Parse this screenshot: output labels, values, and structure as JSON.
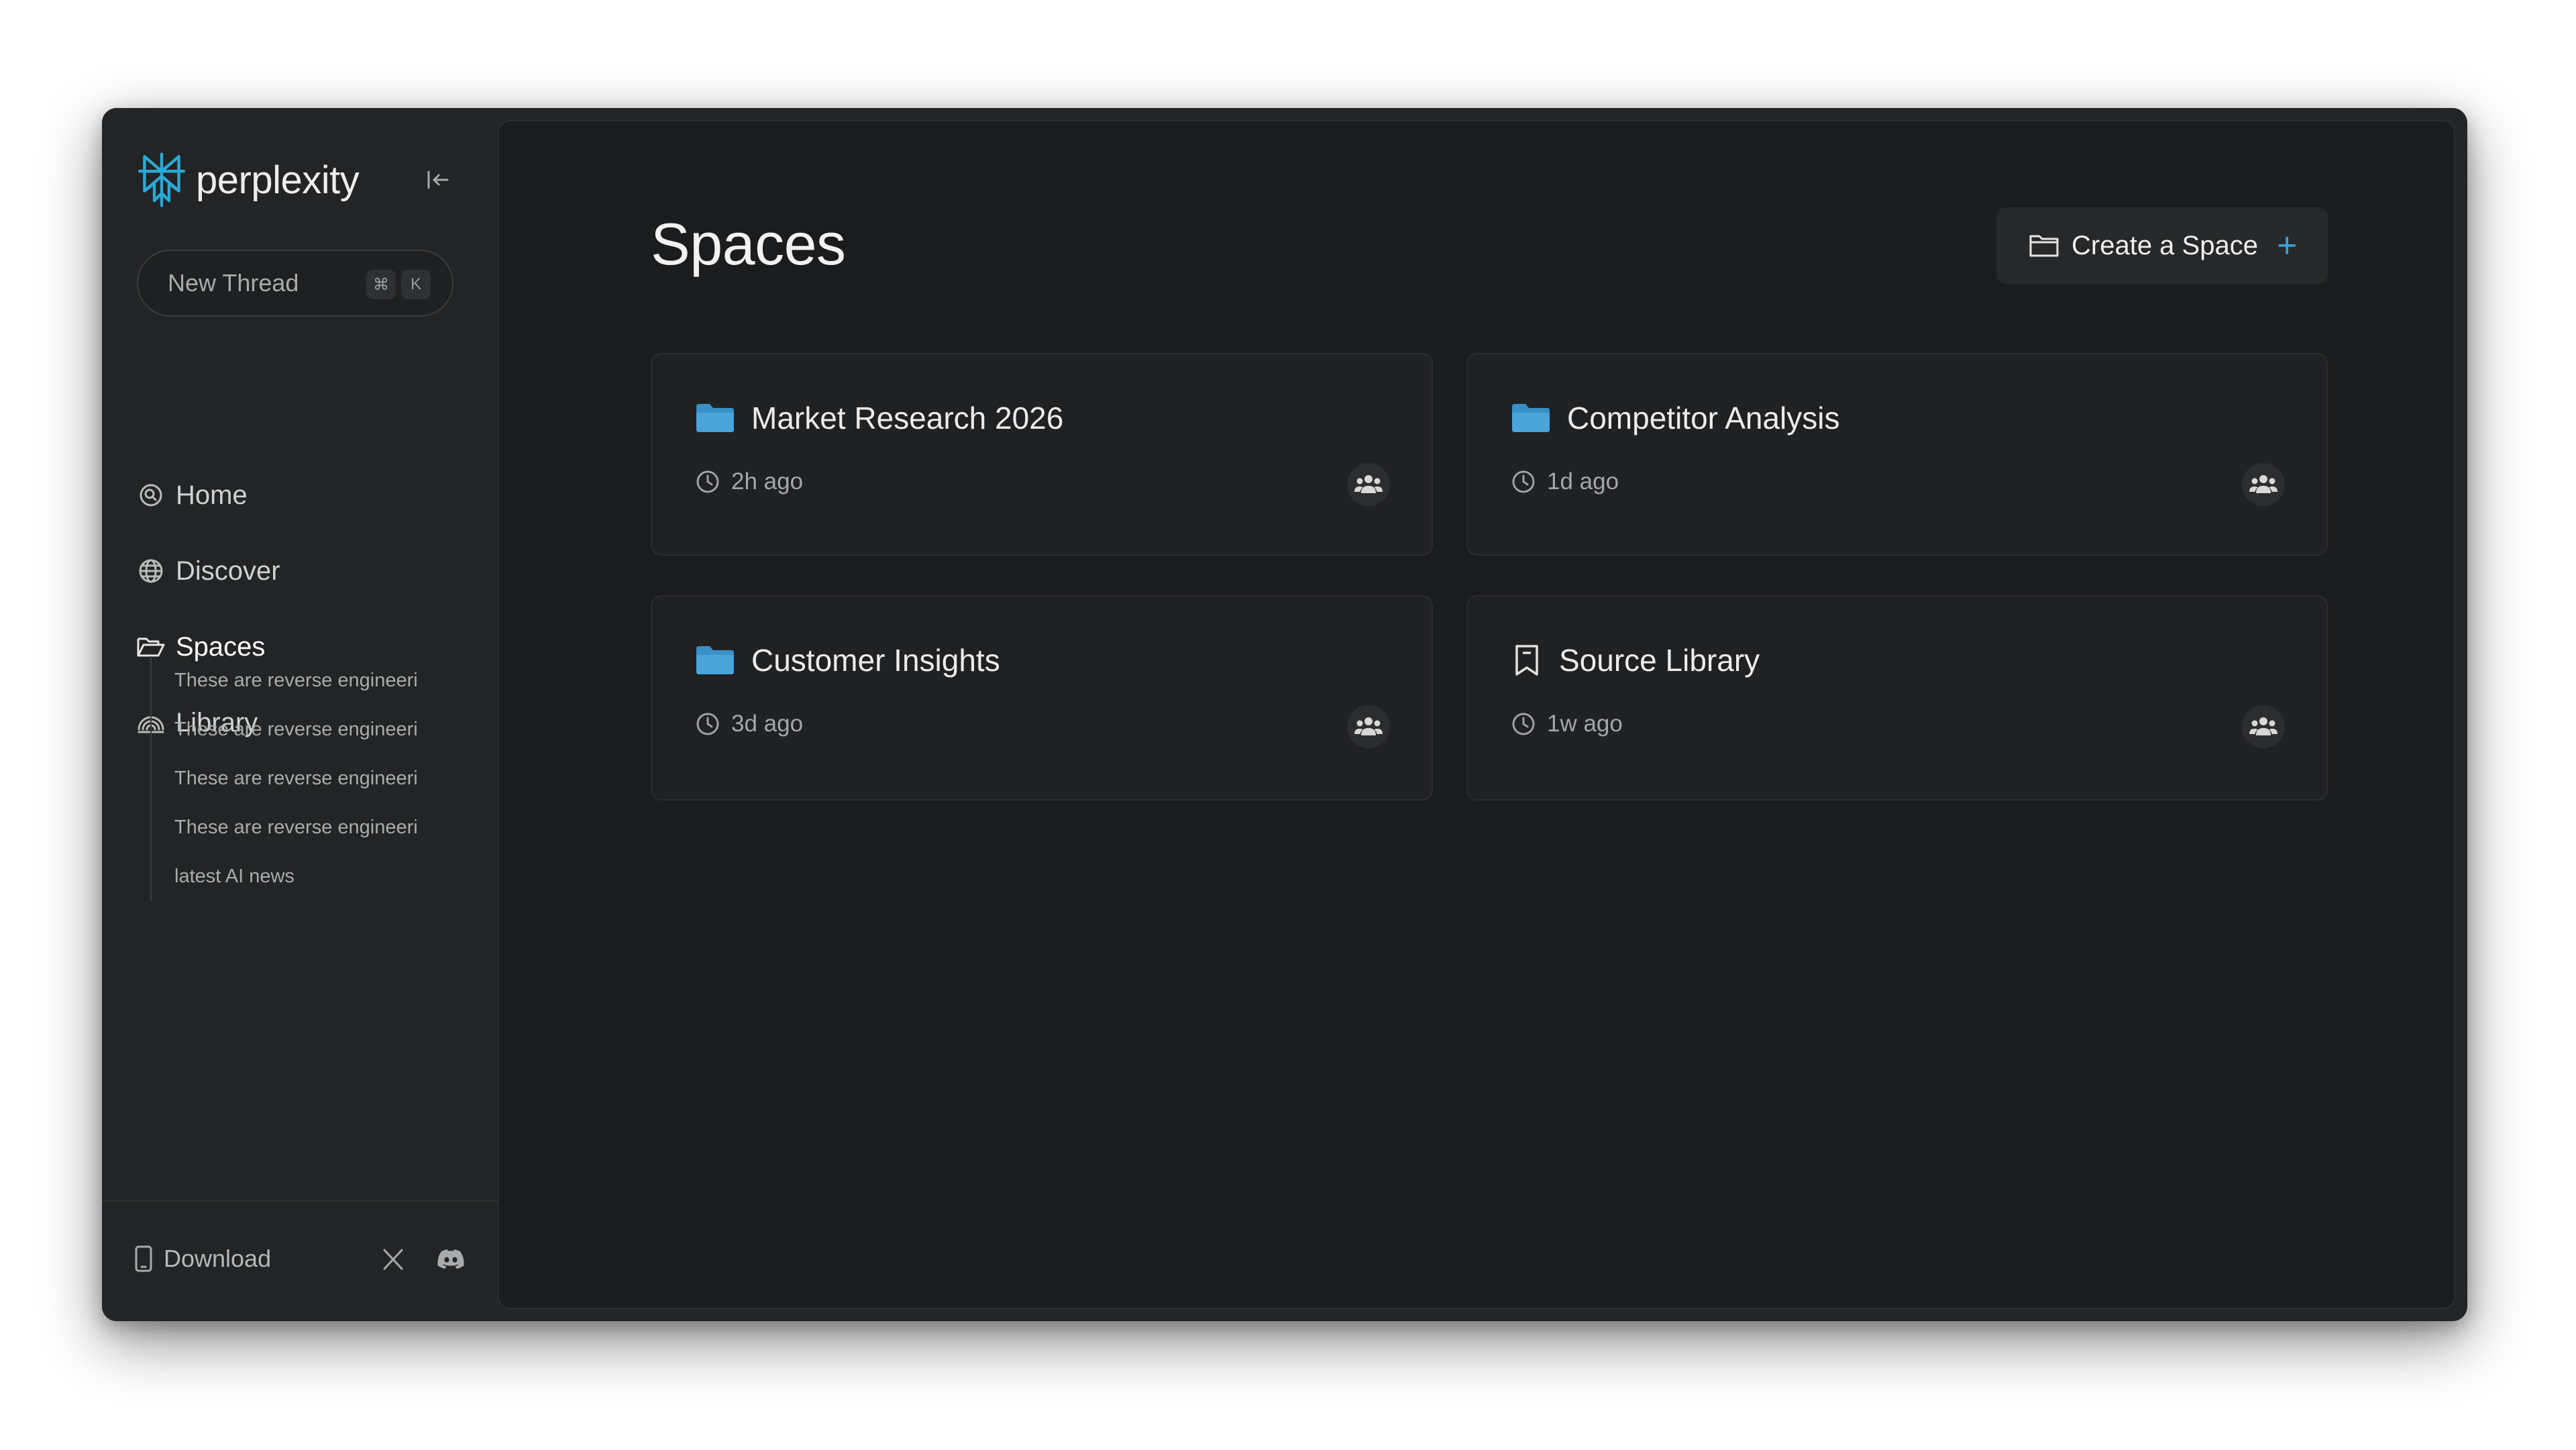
{
  "app": {
    "brand_name": "perplexity",
    "accent_color": "#3a9fd6"
  },
  "sidebar": {
    "new_thread": {
      "label": "New Thread",
      "shortcut_keys": [
        "⌘",
        "K"
      ]
    },
    "nav": [
      {
        "label": "Home",
        "icon": "search-icon"
      },
      {
        "label": "Discover",
        "icon": "globe-icon"
      },
      {
        "label": "Spaces",
        "icon": "open-folder-icon",
        "active": true
      },
      {
        "label": "Library",
        "icon": "library-icon"
      }
    ],
    "library_items": [
      "These are reverse engineeri",
      "These are reverse engineeri",
      "These are reverse engineeri",
      "These are reverse engineeri",
      "latest AI news"
    ],
    "footer": {
      "download_label": "Download"
    }
  },
  "main": {
    "title": "Spaces",
    "create_button_label": "Create a Space",
    "spaces": [
      {
        "name": "Market Research 2026",
        "updated": "2h ago",
        "icon": "folder-icon"
      },
      {
        "name": "Competitor Analysis",
        "updated": "1d ago",
        "icon": "folder-icon"
      },
      {
        "name": "Customer Insights",
        "updated": "3d ago",
        "icon": "folder-icon"
      },
      {
        "name": "Source Library",
        "updated": "1w ago",
        "icon": "bookmark-icon"
      }
    ]
  }
}
